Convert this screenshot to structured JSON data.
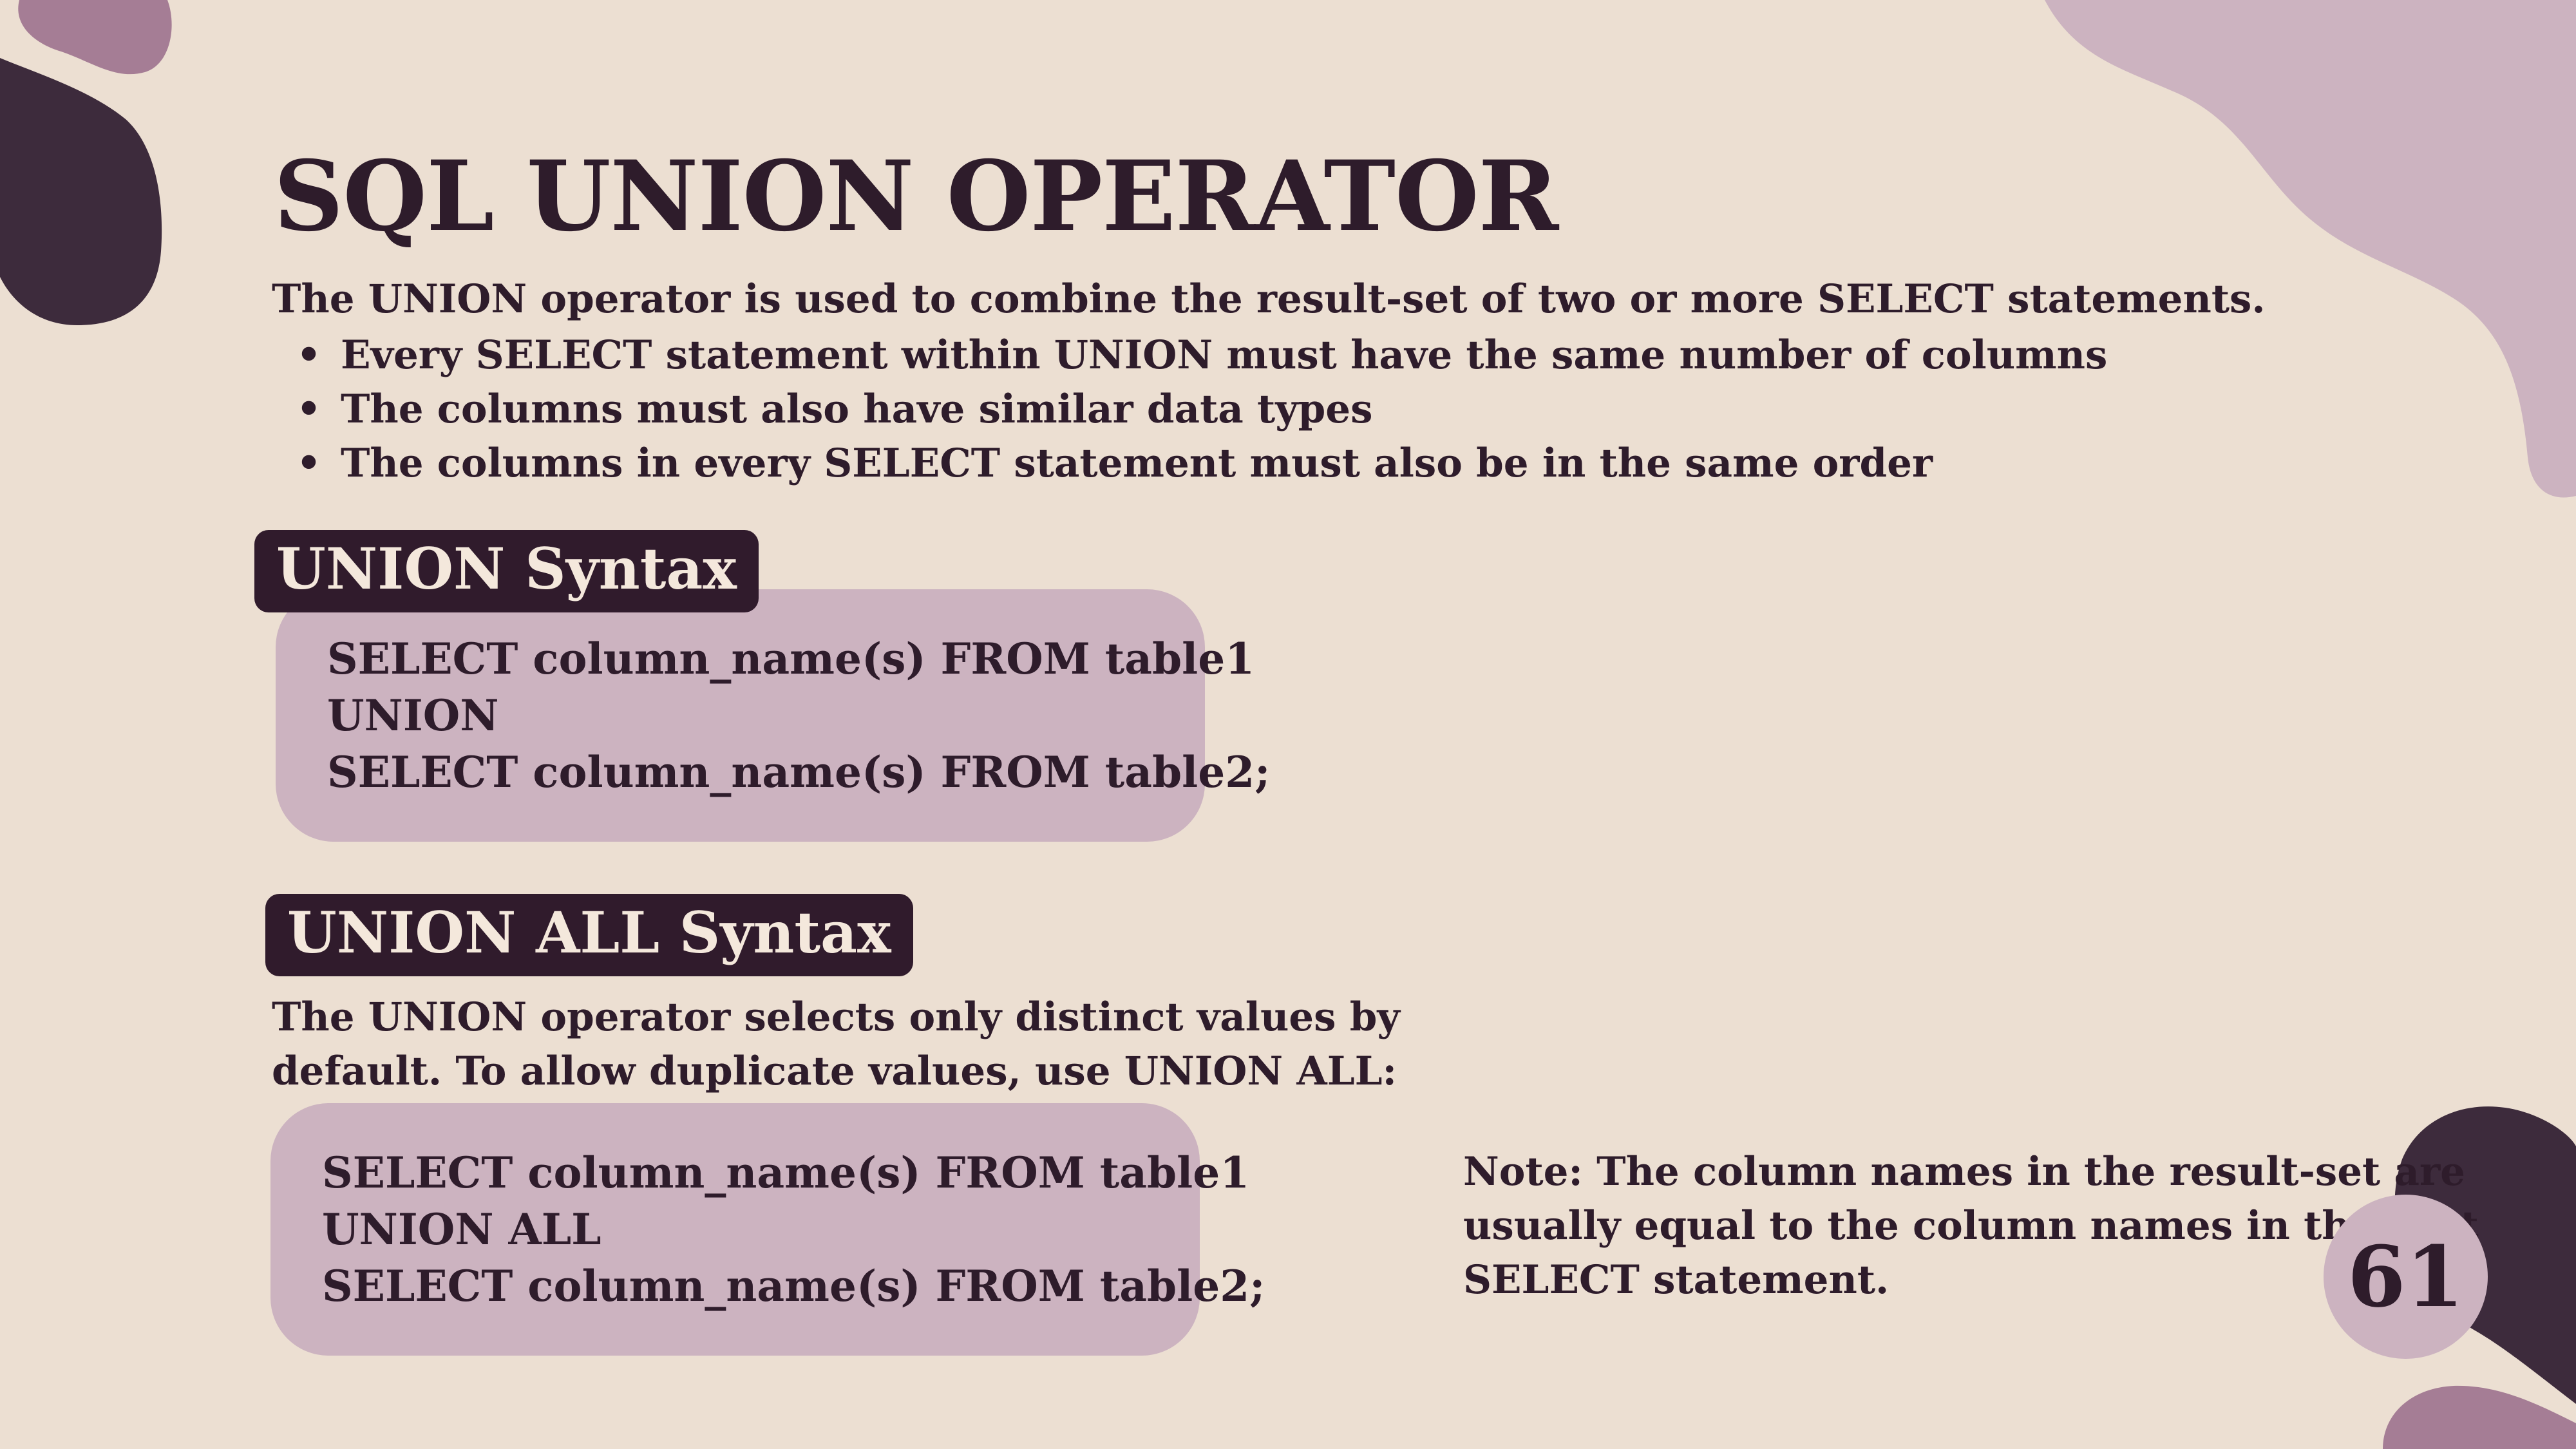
{
  "title": "SQL UNION OPERATOR",
  "intro": "The UNION operator is used to combine the result-set of two or more SELECT statements.",
  "rules": [
    "Every SELECT statement within UNION must have the same number of columns",
    "The columns must also have similar data types",
    "The columns in every SELECT statement must also be in the same order"
  ],
  "union_section": {
    "label": "UNION Syntax",
    "code": [
      "SELECT column_name(s) FROM table1",
      "UNION",
      "SELECT column_name(s) FROM table2;"
    ]
  },
  "union_all_section": {
    "label": "UNION ALL Syntax",
    "description_lines": [
      "The UNION operator selects only distinct values by",
      "default. To allow duplicate values, use UNION ALL:"
    ],
    "code": [
      "SELECT column_name(s) FROM table1",
      "UNION ALL",
      "SELECT column_name(s) FROM table2;"
    ]
  },
  "note_lines": [
    "Note: The column names in the result-set are",
    "usually equal to the column names in the first",
    "SELECT statement."
  ],
  "page_number": "61",
  "colors": {
    "background": "#ecdfd2",
    "dark_plum": "#3d2b3c",
    "mauve": "#a57d95",
    "light_mauve": "#ccb3c0",
    "text": "#2e1c2b"
  }
}
